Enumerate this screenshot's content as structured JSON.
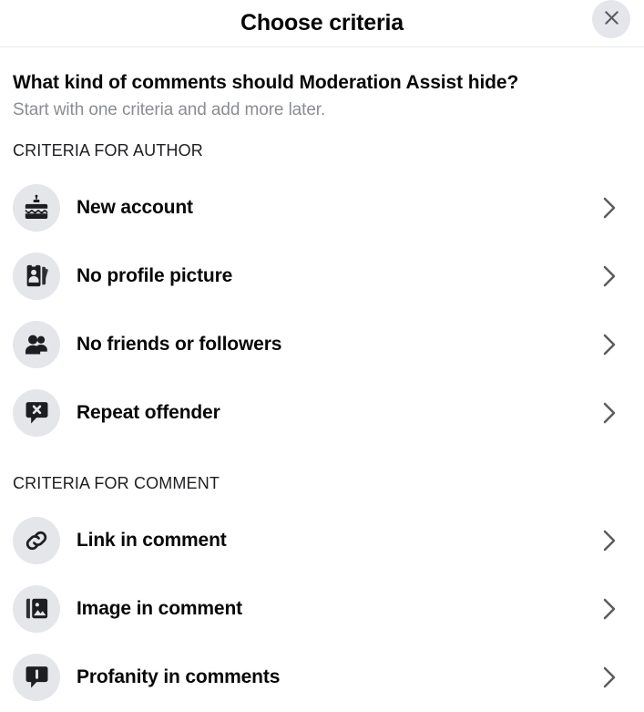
{
  "header": {
    "title": "Choose criteria",
    "close_label": "Close",
    "close_icon": "close-icon"
  },
  "intro": {
    "title": "What kind of comments should Moderation Assist hide?",
    "subtitle": "Start with one criteria and add more later."
  },
  "sections": [
    {
      "header": "CRITERIA FOR AUTHOR",
      "items": [
        {
          "label": "New account",
          "icon": "birthday-cake-icon",
          "chevron": "chevron-right-icon"
        },
        {
          "label": "No profile picture",
          "icon": "profile-card-icon",
          "chevron": "chevron-right-icon"
        },
        {
          "label": "No friends or followers",
          "icon": "people-icon",
          "chevron": "chevron-right-icon"
        },
        {
          "label": "Repeat offender",
          "icon": "comment-x-icon",
          "chevron": "chevron-right-icon"
        }
      ]
    },
    {
      "header": "CRITERIA FOR COMMENT",
      "items": [
        {
          "label": "Link in comment",
          "icon": "link-icon",
          "chevron": "chevron-right-icon"
        },
        {
          "label": "Image in comment",
          "icon": "photo-icon",
          "chevron": "chevron-right-icon"
        },
        {
          "label": "Profanity in comments",
          "icon": "comment-profanity-icon",
          "chevron": "chevron-right-icon"
        }
      ]
    }
  ],
  "colors": {
    "icon_circle_bg": "#e4e6ea",
    "icon_glyph": "#1c1e21",
    "text_primary": "#080809",
    "text_secondary": "#8a8d91",
    "divider": "#e9eaec",
    "close_bg": "#e4e6eb",
    "chevron": "#5a5c60"
  }
}
